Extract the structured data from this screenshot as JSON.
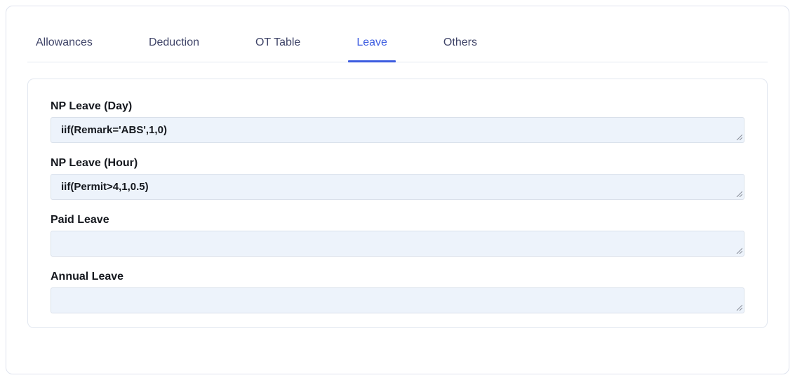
{
  "tabs": {
    "items": [
      {
        "label": "Allowances",
        "active": false
      },
      {
        "label": "Deduction",
        "active": false
      },
      {
        "label": "OT Table",
        "active": false
      },
      {
        "label": "Leave",
        "active": true
      },
      {
        "label": "Others",
        "active": false
      }
    ],
    "active_tab": "Leave"
  },
  "form": {
    "fields": [
      {
        "label": "NP Leave (Day)",
        "value": "iif(Remark='ABS',1,0)"
      },
      {
        "label": "NP Leave (Hour)",
        "value": "iif(Permit>4,1,0.5)"
      },
      {
        "label": "Paid Leave",
        "value": ""
      },
      {
        "label": "Annual Leave",
        "value": ""
      }
    ]
  },
  "colors": {
    "active_tab": "#3c5ce0",
    "inactive_tab": "#3f4468",
    "tab_underline": "#3c5ce0",
    "textarea_background": "#edf3fb",
    "textarea_border": "#d9e0ea",
    "panel_border": "#e2e7f0",
    "label_text": "#15181e"
  }
}
